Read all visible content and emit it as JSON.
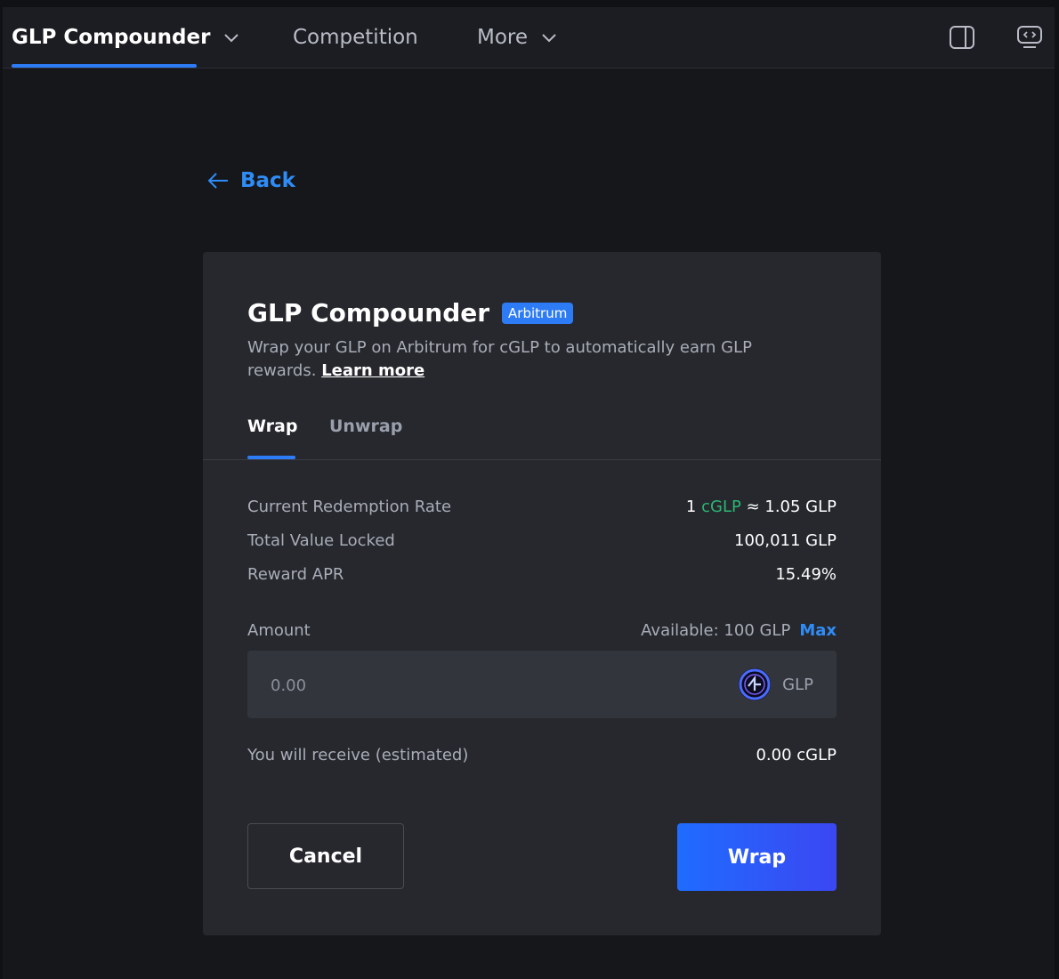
{
  "nav": {
    "items": [
      {
        "label": "GLP Compounder",
        "has_dropdown": true,
        "active": true
      },
      {
        "label": "Competition",
        "has_dropdown": false,
        "active": false
      },
      {
        "label": "More",
        "has_dropdown": true,
        "active": false
      }
    ],
    "right_icons": [
      "panel-toggle-icon",
      "code-chat-icon"
    ],
    "accent_color": "#2d7cf6"
  },
  "back": {
    "label": "Back",
    "icon": "arrow-left-icon"
  },
  "card": {
    "title": "GLP Compounder",
    "badge": "Arbitrum",
    "description": "Wrap your GLP on Arbitrum for cGLP to automatically earn GLP rewards.",
    "learn_more": "Learn more",
    "tabs": [
      {
        "label": "Wrap",
        "active": true
      },
      {
        "label": "Unwrap",
        "active": false
      }
    ],
    "stats": {
      "redemption_label": "Current Redemption Rate",
      "redemption_left": "1",
      "redemption_token": "cGLP",
      "redemption_right": "≈ 1.05 GLP",
      "tvl_label": "Total Value Locked",
      "tvl_value": "100,011 GLP",
      "apr_label": "Reward APR",
      "apr_value": "15.49%"
    },
    "amount": {
      "label": "Amount",
      "available": "Available: 100 GLP",
      "max_label": "Max",
      "placeholder": "0.00",
      "value": "",
      "token": "GLP",
      "token_icon": "glp-token-icon"
    },
    "receive": {
      "label": "You will receive (estimated)",
      "value": "0.00 cGLP"
    },
    "buttons": {
      "cancel": "Cancel",
      "wrap": "Wrap"
    },
    "colors": {
      "green_token": "#2bb673",
      "link_blue": "#2f8cf6"
    }
  }
}
